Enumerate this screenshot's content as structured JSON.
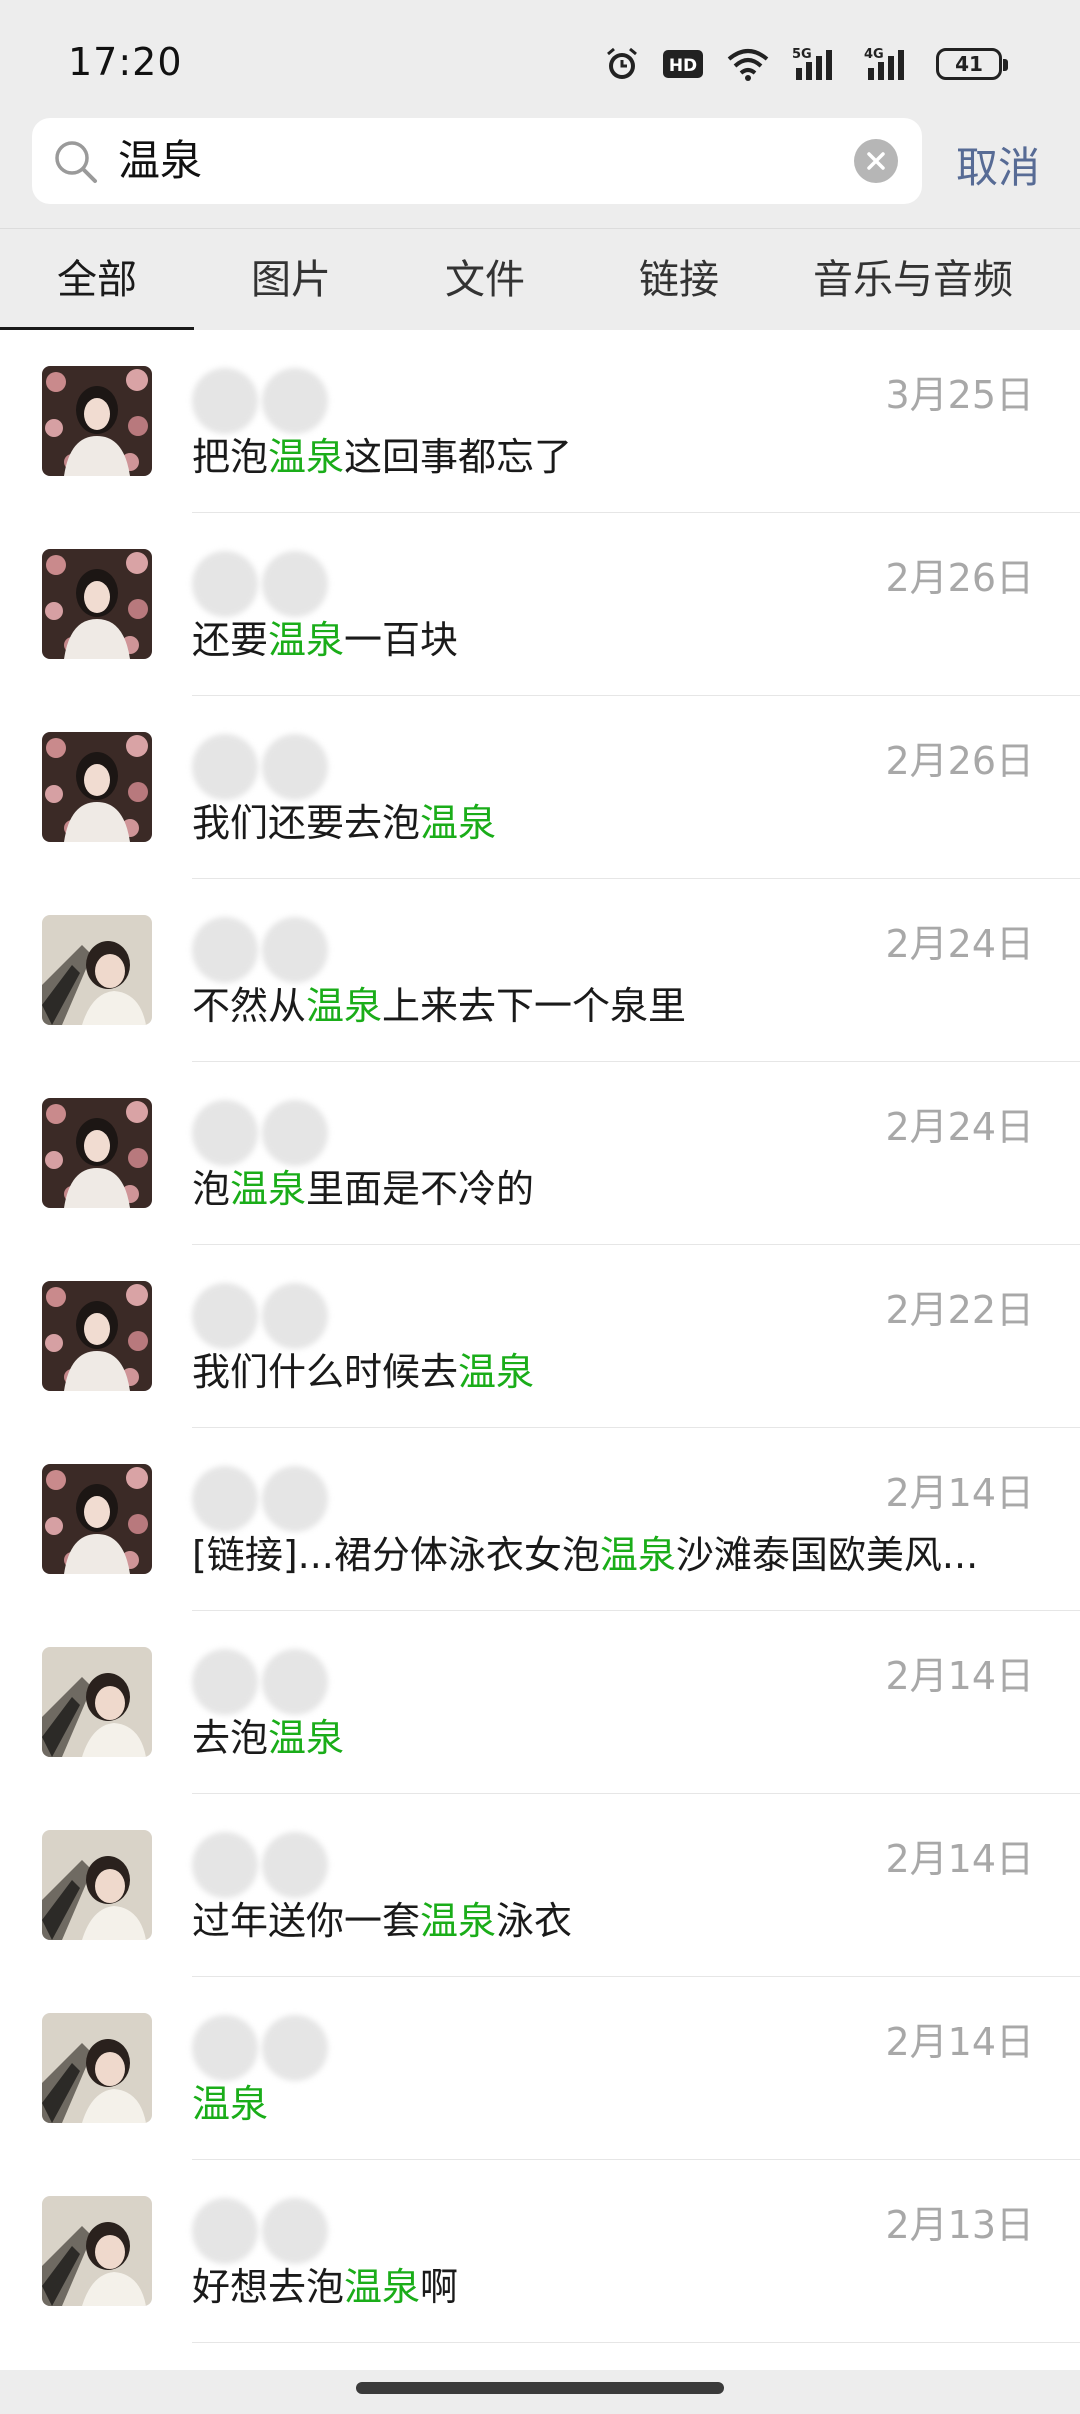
{
  "status_bar": {
    "time": "17:20",
    "battery": "41",
    "icons": [
      "alarm-icon",
      "hd-icon",
      "wifi-icon",
      "signal-5g-icon",
      "signal-4g-icon",
      "battery-icon"
    ]
  },
  "search": {
    "value": "温泉",
    "cancel_label": "取消"
  },
  "tabs": [
    {
      "label": "全部",
      "active": true
    },
    {
      "label": "图片",
      "active": false
    },
    {
      "label": "文件",
      "active": false
    },
    {
      "label": "链接",
      "active": false
    },
    {
      "label": "音乐与音频",
      "active": false
    }
  ],
  "colors": {
    "highlight": "#1aad19",
    "link_blue": "#576b95",
    "date_gray": "#a8a8a8"
  },
  "results": [
    {
      "avatar": "avatar-a",
      "date": "3月25日",
      "message": [
        "把泡",
        "温泉",
        "这回事都忘了"
      ]
    },
    {
      "avatar": "avatar-a",
      "date": "2月26日",
      "message": [
        "还要",
        "温泉",
        "一百块"
      ]
    },
    {
      "avatar": "avatar-a",
      "date": "2月26日",
      "message": [
        "我们还要去泡",
        "温泉",
        ""
      ]
    },
    {
      "avatar": "avatar-b",
      "date": "2月24日",
      "message": [
        "不然从",
        "温泉",
        "上来去下一个泉里"
      ]
    },
    {
      "avatar": "avatar-a",
      "date": "2月24日",
      "message": [
        "泡",
        "温泉",
        "里面是不冷的"
      ]
    },
    {
      "avatar": "avatar-a",
      "date": "2月22日",
      "message": [
        "我们什么时候去",
        "温泉",
        ""
      ]
    },
    {
      "avatar": "avatar-a",
      "date": "2月14日",
      "message": [
        "[链接]...裙分体泳衣女泡",
        "温泉",
        "沙滩泰国欧美风..."
      ]
    },
    {
      "avatar": "avatar-b",
      "date": "2月14日",
      "message": [
        "去泡",
        "温泉",
        ""
      ]
    },
    {
      "avatar": "avatar-b",
      "date": "2月14日",
      "message": [
        "过年送你一套",
        "温泉",
        "泳衣"
      ]
    },
    {
      "avatar": "avatar-b",
      "date": "2月14日",
      "message": [
        "",
        "温泉",
        ""
      ]
    },
    {
      "avatar": "avatar-b",
      "date": "2月13日",
      "message": [
        "好想去泡",
        "温泉",
        "啊"
      ]
    }
  ]
}
